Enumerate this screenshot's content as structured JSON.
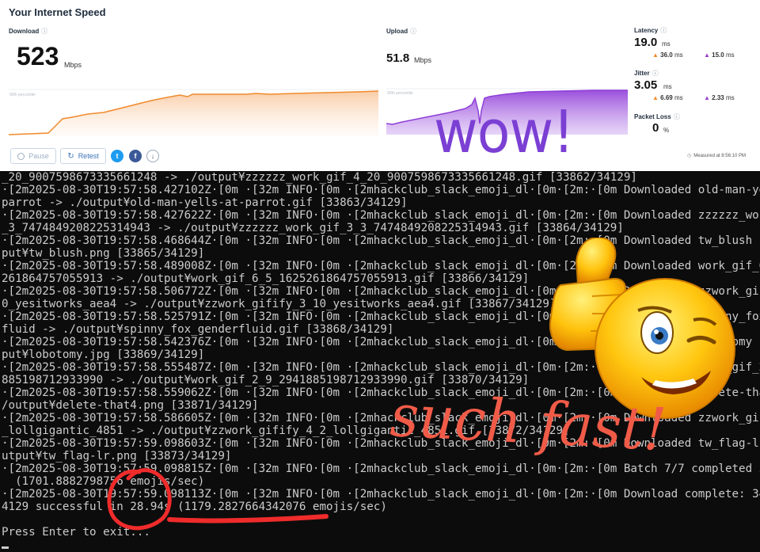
{
  "speedtest": {
    "title": "Your Internet Speed",
    "download": {
      "label": "Download",
      "value": "523",
      "unit": "Mbps",
      "percentile_label": "90th percentile"
    },
    "upload": {
      "label": "Upload",
      "value": "51.8",
      "unit": "Mbps",
      "percentile_label": "90th percentile"
    },
    "latency": {
      "label": "Latency",
      "value": "19.0",
      "unit": "ms",
      "down": "36.0",
      "down_unit": "ms",
      "up": "15.0",
      "up_unit": "ms"
    },
    "jitter": {
      "label": "Jitter",
      "value": "3.05",
      "unit": "ms",
      "down": "6.69",
      "down_unit": "ms",
      "up": "2.33",
      "up_unit": "ms"
    },
    "packet_loss": {
      "label": "Packet Loss",
      "value": "0",
      "unit": "%"
    },
    "buttons": {
      "pause": "Pause",
      "retest": "Retest"
    },
    "measured": "Measured at 8:56:10 PM",
    "info_icon": "ⓘ",
    "colors": {
      "download": "#f08a2c",
      "upload": "#8e3fd6",
      "arrow_down": "#f08a2c",
      "arrow_up": "#9b40d0"
    }
  },
  "overlay": {
    "wow": "wow!",
    "such_fast": "such fast!"
  },
  "terminal": {
    "lines": [
      "_20_9007598673335661248 -> ./output¥zzzzzz_work_gif_4_20_9007598673335661248.gif [33862/34129]",
      "·[2m2025-08-30T19:57:58.427102Z·[0m ·[32m INFO·[0m ·[2mhackclub_slack_emoji_dl·[0m·[2m:·[0m Downloaded old-man-yells-at-",
      "parrot -> ./output¥old-man-yells-at-parrot.gif [33863/34129]",
      "·[2m2025-08-30T19:57:58.427622Z·[0m ·[32m INFO·[0m ·[2mhackclub_slack_emoji_dl·[0m·[2m:·[0m Downloaded zzzzzz_work_gif_3",
      "_3_7474849208225314943 -> ./output¥zzzzzz_work_gif_3_3_7474849208225314943.gif [33864/34129]",
      "·[2m2025-08-30T19:57:58.468644Z·[0m ·[32m INFO·[0m ·[2mhackclub_slack_emoji_dl·[0m·[2m:·[0m Downloaded tw_blush -> ./out",
      "put¥tw_blush.png [33865/34129]",
      "·[2m2025-08-30T19:57:58.489008Z·[0m ·[32m INFO·[0m ·[2mhackclub_slack_emoji_dl·[0m·[2m:·[0m Downloaded work_gif_6_5_1625",
      "261864757055913 -> ./output¥work_gif_6_5_1625261864757055913.gif [33866/34129]",
      "·[2m2025-08-30T19:57:58.506772Z·[0m ·[32m INFO·[0m ·[2mhackclub_slack_emoji_dl·[0m·[2m:·[0m Downloaded zzwork_gifify_3_1",
      "0_yesitworks_aea4 -> ./output¥zzwork_gifify_3_10_yesitworks_aea4.gif [33867/34129]",
      "·[2m2025-08-30T19:57:58.525791Z·[0m ·[32m INFO·[0m ·[2mhackclub_slack_emoji_dl·[0m·[2m:·[0m Downloaded spinny_fox_gender",
      "fluid -> ./output¥spinny_fox_genderfluid.gif [33868/34129]",
      "·[2m2025-08-30T19:57:58.542376Z·[0m ·[32m INFO·[0m ·[2mhackclub_slack_emoji_dl·[0m·[2m:·[0m Downloaded lobotomy -> ./out",
      "put¥lobotomy.jpg [33869/34129]",
      "·[2m2025-08-30T19:57:58.555487Z·[0m ·[32m INFO·[0m ·[2mhackclub_slack_emoji_dl·[0m·[2m:·[0m Downloaded work_gif_2_9_2941",
      "885198712933990 -> ./output¥work_gif_2_9_2941885198712933990.gif [33870/34129]",
      "·[2m2025-08-30T19:57:58.559062Z·[0m ·[32m INFO·[0m ·[2mhackclub_slack_emoji_dl·[0m·[2m:·[0m Downloaded delete-that4 -> .",
      "/output¥delete-that4.png [33871/34129]",
      "·[2m2025-08-30T19:57:58.586605Z·[0m ·[32m INFO·[0m ·[2mhackclub_slack_emoji_dl·[0m·[2m:·[0m Downloaded zzwork_gifify_4_2",
      "_lollgigantic_4851 -> ./output¥zzwork_gifify_4_2_lollgigantic_4851.gif [33872/34129]",
      "·[2m2025-08-30T19:57:59.098603Z·[0m ·[32m INFO·[0m ·[2mhackclub_slack_emoji_dl·[0m·[2m:·[0m Downloaded tw_flag-lr -> ./o",
      "utput¥tw_flag-lr.png [33873/34129]",
      "·[2m2025-08-30T19:57:59.098815Z·[0m ·[32m INFO·[0m ·[2mhackclub_slack_emoji_dl·[0m·[2m:·[0m Batch 7/7 completed in 2.43s",
      "  (1701.8882798756 emojis/sec)",
      "·[2m2025-08-30T19:57:59.098113Z·[0m ·[32m INFO·[0m ·[2mhackclub_slack_emoji_dl·[0m·[2m:·[0m Download complete: 34129 / 3",
      "4129 successful in 28.94s (1179.2827664342076 emojis/sec)",
      "",
      "Press Enter to exit..."
    ]
  }
}
